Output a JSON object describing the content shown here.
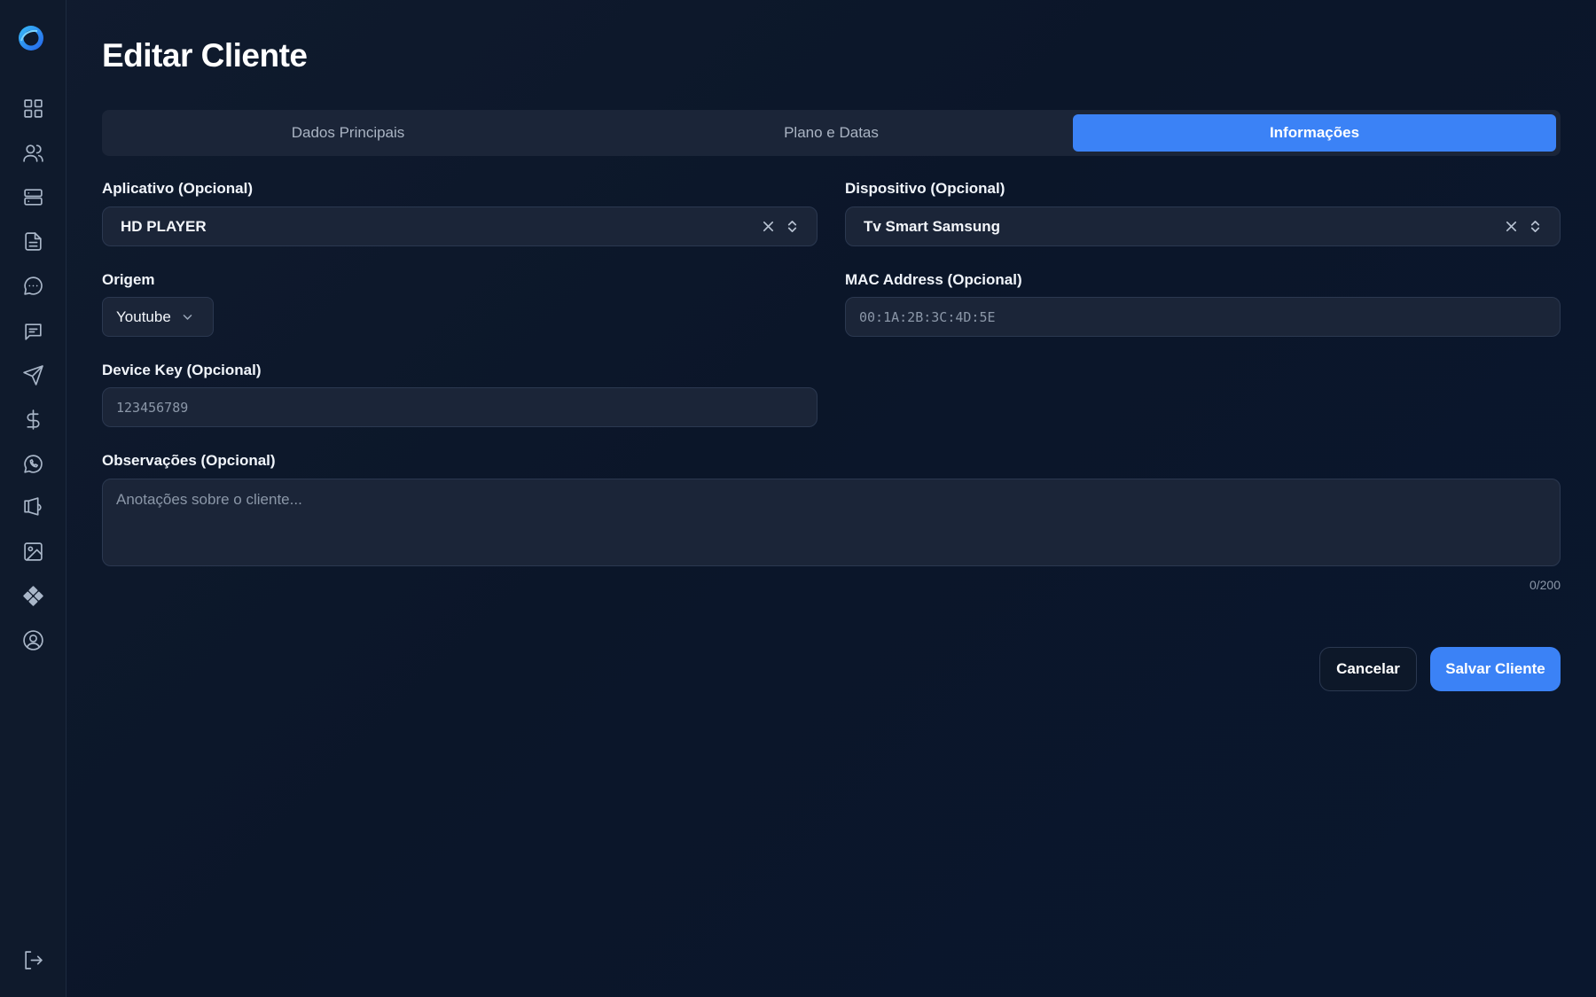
{
  "page": {
    "title": "Editar Cliente"
  },
  "sidebar": {
    "items": [
      {
        "icon": "dashboard-grid-icon"
      },
      {
        "icon": "users-icon"
      },
      {
        "icon": "servers-icon"
      },
      {
        "icon": "document-icon"
      },
      {
        "icon": "chat-dots-icon"
      },
      {
        "icon": "message-square-icon"
      },
      {
        "icon": "send-icon"
      },
      {
        "icon": "dollar-icon"
      },
      {
        "icon": "whatsapp-icon"
      },
      {
        "icon": "megaphone-icon"
      },
      {
        "icon": "image-icon"
      },
      {
        "icon": "diamond-cluster-icon"
      },
      {
        "icon": "user-circle-icon"
      }
    ],
    "logout_icon": "logout-icon",
    "logo_icon": "app-logo-icon"
  },
  "tabs": [
    {
      "label": "Dados Principais",
      "active": false
    },
    {
      "label": "Plano e Datas",
      "active": false
    },
    {
      "label": "Informações",
      "active": true
    }
  ],
  "form": {
    "aplicativo": {
      "label": "Aplicativo (Opcional)",
      "value": "HD PLAYER"
    },
    "dispositivo": {
      "label": "Dispositivo (Opcional)",
      "value": "Tv Smart Samsung"
    },
    "origem": {
      "label": "Origem",
      "value": "Youtube"
    },
    "mac": {
      "label": "MAC Address (Opcional)",
      "placeholder": "00:1A:2B:3C:4D:5E"
    },
    "device_key": {
      "label": "Device Key (Opcional)",
      "placeholder": "123456789"
    },
    "observacoes": {
      "label": "Observações (Opcional)",
      "placeholder": "Anotações sobre o cliente...",
      "counter": "0/200"
    }
  },
  "actions": {
    "cancel_label": "Cancelar",
    "save_label": "Salvar Cliente"
  },
  "colors": {
    "accent": "#3b82f6",
    "background": "#0c1628",
    "surface": "#1b2538"
  }
}
